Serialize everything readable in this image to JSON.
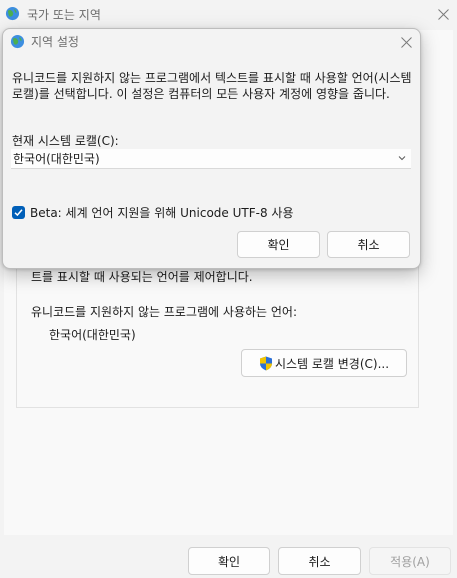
{
  "background_window": {
    "title": "국가 또는 지역",
    "group": {
      "line1": "트를 표시할 때 사용되는 언어를 제어합니다.",
      "line2": "유니코드를 지원하지 않는 프로그램에 사용하는 언어:",
      "current_locale": "한국어(대한민국)",
      "change_button": "시스템 로캘 변경(C)..."
    },
    "footer": {
      "ok": "확인",
      "cancel": "취소",
      "apply": "적용(A)"
    }
  },
  "dialog": {
    "title": "지역 설정",
    "description": "유니코드를 지원하지 않는 프로그램에서 텍스트를 표시할 때 사용할 언어(시스템 로캘)를 선택합니다. 이 설정은 컴퓨터의 모든 사용자 계정에 영향을 줍니다.",
    "locale_label": "현재 시스템 로캘(C):",
    "locale_value": "한국어(대한민국)",
    "beta_checkbox": {
      "label": "Beta: 세계 언어 지원을 위해 Unicode UTF-8 사용",
      "checked": true
    },
    "ok": "확인",
    "cancel": "취소"
  },
  "colors": {
    "accent": "#005fb8",
    "shield_blue": "#2b6fd6",
    "shield_yellow": "#f2c400"
  }
}
